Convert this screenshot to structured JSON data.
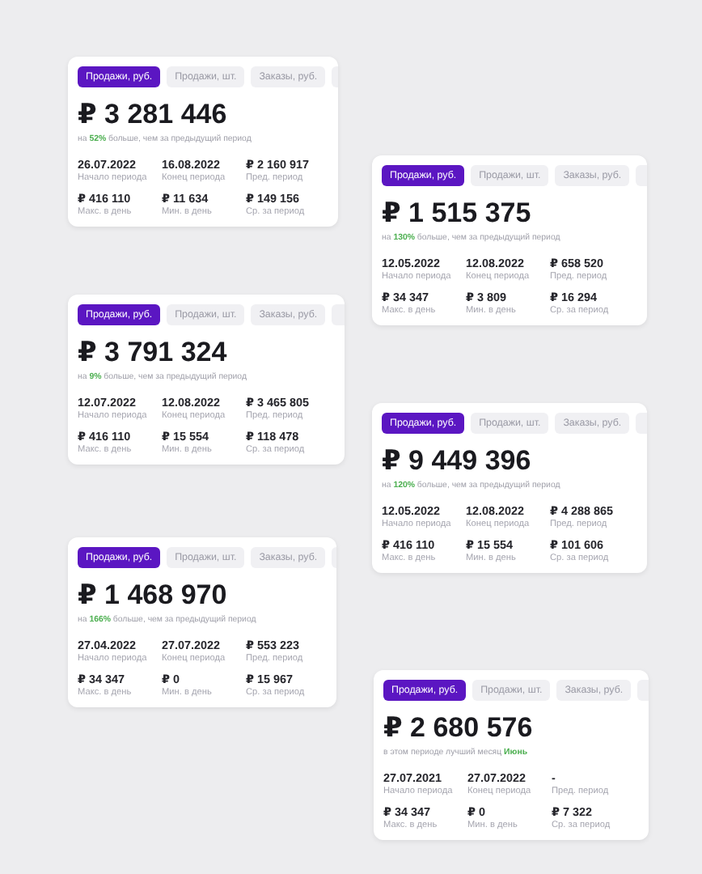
{
  "cards": [
    {
      "tabs": [
        {
          "label": "Продажи, руб.",
          "selected": true
        },
        {
          "label": "Продажи, шт.",
          "selected": false
        },
        {
          "label": "Заказы, руб.",
          "selected": false
        }
      ],
      "total": "₽ 3 281 446",
      "note": "на **52%** больше, чем за предыдущий период",
      "stats": [
        {
          "value": "26.07.2022",
          "label": "Начало периода"
        },
        {
          "value": "16.08.2022",
          "label": "Конец периода"
        },
        {
          "value": "₽ 2 160 917",
          "label": "Пред. период"
        },
        {
          "value": "₽ 416 110",
          "label": "Макс. в день"
        },
        {
          "value": "₽ 11 634",
          "label": "Мин. в день"
        },
        {
          "value": "₽ 149 156",
          "label": "Ср. за период"
        }
      ]
    },
    {
      "tabs": [
        {
          "label": "Продажи, руб.",
          "selected": true
        },
        {
          "label": "Продажи, шт.",
          "selected": false
        },
        {
          "label": "Заказы, руб.",
          "selected": false
        }
      ],
      "total": "₽ 1 515 375",
      "note": "на **130%** больше, чем за предыдущий период",
      "stats": [
        {
          "value": "12.05.2022",
          "label": "Начало периода"
        },
        {
          "value": "12.08.2022",
          "label": "Конец периода"
        },
        {
          "value": "₽ 658 520",
          "label": "Пред. период"
        },
        {
          "value": "₽ 34 347",
          "label": "Макс. в день"
        },
        {
          "value": "₽ 3 809",
          "label": "Мин. в день"
        },
        {
          "value": "₽ 16 294",
          "label": "Ср. за период"
        }
      ]
    },
    {
      "tabs": [
        {
          "label": "Продажи, руб.",
          "selected": true
        },
        {
          "label": "Продажи, шт.",
          "selected": false
        },
        {
          "label": "Заказы, руб.",
          "selected": false
        }
      ],
      "total": "₽ 3 791 324",
      "note": "на **9%** больше, чем за предыдущий период",
      "stats": [
        {
          "value": "12.07.2022",
          "label": "Начало периода"
        },
        {
          "value": "12.08.2022",
          "label": "Конец периода"
        },
        {
          "value": "₽ 3 465 805",
          "label": "Пред. период"
        },
        {
          "value": "₽ 416 110",
          "label": "Макс. в день"
        },
        {
          "value": "₽ 15 554",
          "label": "Мин. в день"
        },
        {
          "value": "₽ 118 478",
          "label": "Ср. за период"
        }
      ]
    },
    {
      "tabs": [
        {
          "label": "Продажи, руб.",
          "selected": true
        },
        {
          "label": "Продажи, шт.",
          "selected": false
        },
        {
          "label": "Заказы, руб.",
          "selected": false
        }
      ],
      "total": "₽ 9 449 396",
      "note": "на **120%** больше, чем за предыдущий период",
      "stats": [
        {
          "value": "12.05.2022",
          "label": "Начало периода"
        },
        {
          "value": "12.08.2022",
          "label": "Конец периода"
        },
        {
          "value": "₽ 4 288 865",
          "label": "Пред. период"
        },
        {
          "value": "₽ 416 110",
          "label": "Макс. в день"
        },
        {
          "value": "₽ 15 554",
          "label": "Мин. в день"
        },
        {
          "value": "₽ 101 606",
          "label": "Ср. за период"
        }
      ]
    },
    {
      "tabs": [
        {
          "label": "Продажи, руб.",
          "selected": true
        },
        {
          "label": "Продажи, шт.",
          "selected": false
        },
        {
          "label": "Заказы, руб.",
          "selected": false
        }
      ],
      "total": "₽ 1 468 970",
      "note": "на **166%** больше, чем за предыдущий период",
      "stats": [
        {
          "value": "27.04.2022",
          "label": "Начало периода"
        },
        {
          "value": "27.07.2022",
          "label": "Конец периода"
        },
        {
          "value": "₽ 553 223",
          "label": "Пред. период"
        },
        {
          "value": "₽ 34 347",
          "label": "Макс. в день"
        },
        {
          "value": "₽ 0",
          "label": "Мин. в день"
        },
        {
          "value": "₽ 15 967",
          "label": "Ср. за период"
        }
      ]
    },
    {
      "tabs": [
        {
          "label": "Продажи, руб.",
          "selected": true
        },
        {
          "label": "Продажи, шт.",
          "selected": false
        },
        {
          "label": "Заказы, руб.",
          "selected": false
        }
      ],
      "total": "₽ 2 680 576",
      "note": "в этом периоде лучший месяц **Июнь**",
      "stats": [
        {
          "value": "27.07.2021",
          "label": "Начало периода"
        },
        {
          "value": "27.07.2022",
          "label": "Конец периода"
        },
        {
          "value": "-",
          "label": "Пред. период"
        },
        {
          "value": "₽ 34 347",
          "label": "Макс. в день"
        },
        {
          "value": "₽ 0",
          "label": "Мин. в день"
        },
        {
          "value": "₽ 7 322",
          "label": "Ср. за период"
        }
      ]
    }
  ]
}
